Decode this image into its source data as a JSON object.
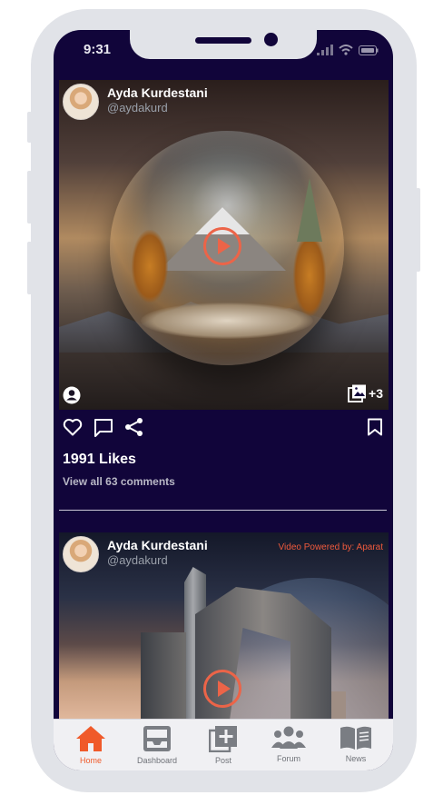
{
  "status_bar": {
    "time": "9:31"
  },
  "posts": [
    {
      "author": {
        "name": "Ayda Kurdestani",
        "handle": "@aydakurd"
      },
      "media_count_badge": "+3",
      "likes_label": "1991 Likes",
      "comments_label": "View all 63 comments"
    },
    {
      "author": {
        "name": "Ayda Kurdestani",
        "handle": "@aydakurd"
      },
      "powered_by": "Video Powered by: Aparat"
    }
  ],
  "bottom_nav": {
    "items": [
      {
        "label": "Home",
        "icon": "home-icon",
        "active": true
      },
      {
        "label": "Dashboard",
        "icon": "inbox-icon",
        "active": false
      },
      {
        "label": "Post",
        "icon": "add-post-icon",
        "active": false
      },
      {
        "label": "Forum",
        "icon": "people-icon",
        "active": false
      },
      {
        "label": "News",
        "icon": "book-icon",
        "active": false
      }
    ]
  },
  "colors": {
    "screen_bg": "#11053a",
    "accent": "#f05a2a",
    "frame": "#e1e3e8"
  }
}
